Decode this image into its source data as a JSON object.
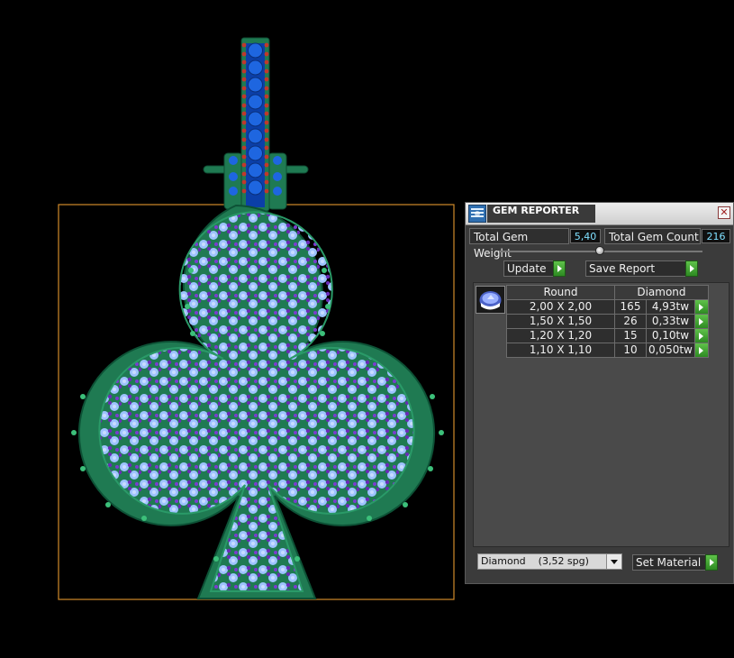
{
  "panel": {
    "title": "GEM REPORTER",
    "close_glyph": "✕",
    "total_weight_label": "Total Gem Weight",
    "total_weight_value": "5,40",
    "total_count_label": "Total Gem Count",
    "total_count_value": "216",
    "update_label": "Update",
    "save_report_label": "Save Report",
    "table": {
      "headers": [
        "Round",
        "Diamond"
      ],
      "rows": [
        {
          "size": "2,00 X 2,00",
          "count": "165",
          "weight": "4,93tw"
        },
        {
          "size": "1,50 X 1,50",
          "count": "26",
          "weight": "0,33tw"
        },
        {
          "size": "1,20 X 1,20",
          "count": "15",
          "weight": "0,10tw"
        },
        {
          "size": "1,10 X 1,10",
          "count": "10",
          "weight": "0,050tw"
        }
      ]
    },
    "material_value": "Diamond    (3,52 spg)",
    "set_material_label": "Set Material"
  },
  "icons": {
    "app": "gem-reporter-icon",
    "close": "close-icon",
    "gem_preview": "round-gem-icon",
    "arrow": "play-arrow-icon",
    "dropdown": "chevron-down-icon"
  },
  "colors": {
    "metal_green": "#1f7a52",
    "gem_light_blue": "#8fb8ff",
    "gem_purple": "#6a2bb8",
    "bail_blue": "#1550c8",
    "bounding_box": "#d08a2a",
    "panel_bg": "#3b3b3b",
    "value_cyan": "#7fe0ff",
    "button_green": "#3aa12c"
  }
}
